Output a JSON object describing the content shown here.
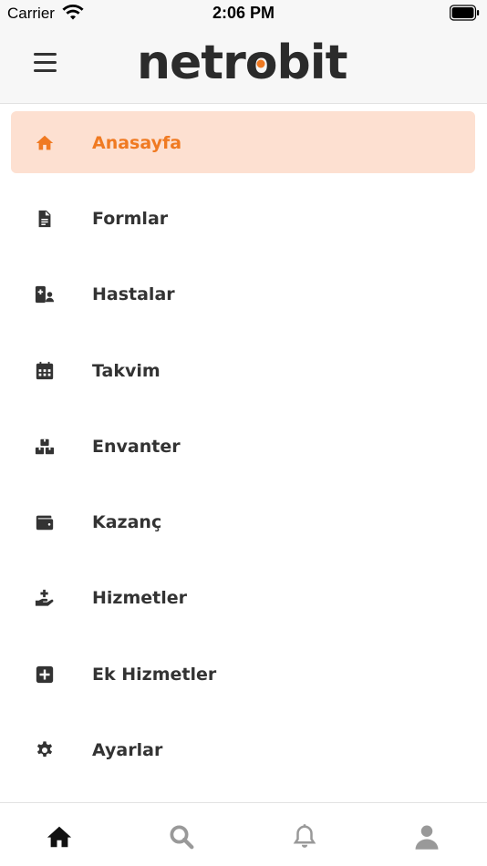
{
  "status_bar": {
    "carrier": "Carrier",
    "time": "2:06 PM"
  },
  "header": {
    "logo_text_before": "netr",
    "logo_text_o": "o",
    "logo_text_after": "bit"
  },
  "colors": {
    "accent": "#f07a22",
    "active_bg": "#fde0d1",
    "text": "#333333",
    "inactive_tab": "#999999"
  },
  "menu": {
    "items": [
      {
        "label": "Anasayfa",
        "icon": "home-icon",
        "active": true
      },
      {
        "label": "Formlar",
        "icon": "document-icon",
        "active": false
      },
      {
        "label": "Hastalar",
        "icon": "patients-icon",
        "active": false
      },
      {
        "label": "Takvim",
        "icon": "calendar-icon",
        "active": false
      },
      {
        "label": "Envanter",
        "icon": "boxes-icon",
        "active": false
      },
      {
        "label": "Kazanç",
        "icon": "wallet-icon",
        "active": false
      },
      {
        "label": "Hizmetler",
        "icon": "hand-plus-icon",
        "active": false
      },
      {
        "label": "Ek Hizmetler",
        "icon": "plus-square-icon",
        "active": false
      },
      {
        "label": "Ayarlar",
        "icon": "gear-icon",
        "active": false
      }
    ]
  },
  "tabbar": {
    "tabs": [
      {
        "icon": "home-icon",
        "active": true
      },
      {
        "icon": "search-icon",
        "active": false
      },
      {
        "icon": "bell-icon",
        "active": false
      },
      {
        "icon": "user-icon",
        "active": false
      }
    ]
  }
}
